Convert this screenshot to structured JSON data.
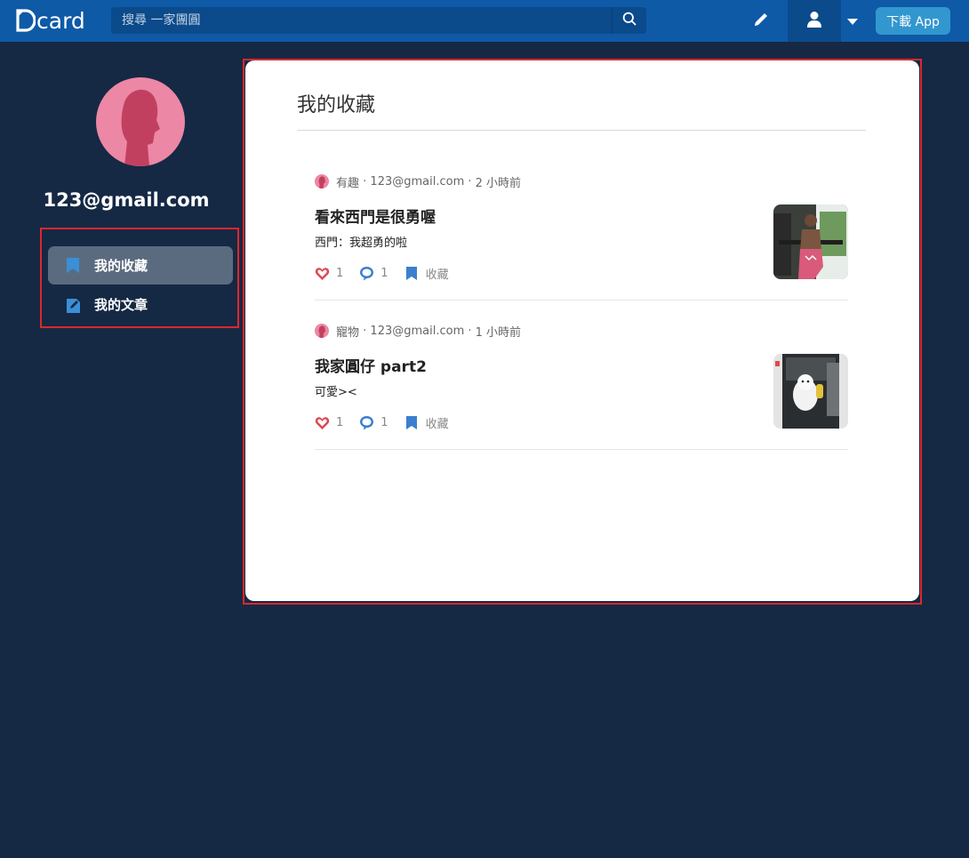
{
  "colors": {
    "background": "#152944",
    "topbar": "#0e5aa7",
    "accent": "#3397cf",
    "highlight_frame": "#e0262a",
    "avatar_pink": "#ec87a5",
    "like_red": "#e0484f",
    "comment_blue": "#3a7fd0"
  },
  "header": {
    "logo_text": "card",
    "search_placeholder": "搜尋 一家團圓",
    "download_label": "下載 App",
    "icons": [
      "search-icon",
      "pencil-icon",
      "user-icon",
      "caret-down-icon"
    ]
  },
  "profile": {
    "username": "123@gmail.com"
  },
  "sidebar": {
    "items": [
      {
        "label": "我的收藏",
        "icon": "bookmark-icon",
        "active": true
      },
      {
        "label": "我的文章",
        "icon": "edit-document-icon",
        "active": false
      }
    ]
  },
  "main": {
    "title": "我的收藏",
    "posts": [
      {
        "forum": "有趣",
        "author": "123@gmail.com",
        "time": "2 小時前",
        "title": "看來西門是很勇喔",
        "excerpt": "西門：我超勇的啦",
        "likes": "1",
        "comments": "1",
        "save_label": "收藏",
        "thumb": "photo-man-thumbnail"
      },
      {
        "forum": "寵物",
        "author": "123@gmail.com",
        "time": "1 小時前",
        "title": "我家圓仔 part2",
        "excerpt": "可愛><",
        "likes": "1",
        "comments": "1",
        "save_label": "收藏",
        "thumb": "photo-dog-thumbnail"
      }
    ]
  }
}
